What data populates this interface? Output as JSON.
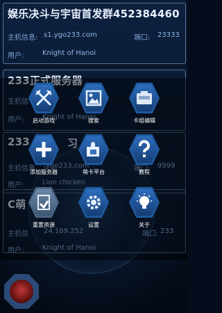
{
  "servers": [
    {
      "name": "娱乐决斗与宇宙首发群452384460",
      "host_label": "主机信息:",
      "host": "s1.ygo233.com",
      "port_label": "端口:",
      "port": "23333",
      "user_label": "用户:",
      "user": "Knight of Hanoi"
    },
    {
      "name": "233正式服务器",
      "host_label": "主机信",
      "host": "",
      "port_label": "",
      "port": "",
      "user_label": "用户:",
      "user": "Knight of Hanoi"
    },
    {
      "name": "233",
      "name_tail": "习",
      "host_label": "主机信息",
      "host": ".ygo233.com",
      "port_label": "端口:",
      "port": "9999",
      "user_label": "用户:",
      "user": "Lion chicken"
    },
    {
      "name": "C萌",
      "host_label": "主机信",
      "host": "24.169.252",
      "port_label": "端口:",
      "port": "233",
      "user_label": "用户:",
      "user": "Knight of Hanoi"
    }
  ],
  "menu": [
    {
      "label": "启动游戏",
      "icon": "swords-icon"
    },
    {
      "label": "搜索",
      "icon": "image-search-icon"
    },
    {
      "label": "卡组编辑",
      "icon": "deck-edit-icon"
    },
    {
      "label": "添加服务器",
      "icon": "plus-icon"
    },
    {
      "label": "萌卡平台",
      "icon": "puzzle-icon"
    },
    {
      "label": "教程",
      "icon": "question-icon"
    },
    {
      "label": "重置资源",
      "icon": "reset-resources-icon"
    },
    {
      "label": "设置",
      "icon": "gear-icon"
    },
    {
      "label": "关于",
      "icon": "lightbulb-icon"
    }
  ],
  "colors": {
    "background": "#050d1c",
    "hex_active": "#1e5aa0",
    "hex_inactive": "#4a6585",
    "text_secondary": "#7fa6d6"
  }
}
